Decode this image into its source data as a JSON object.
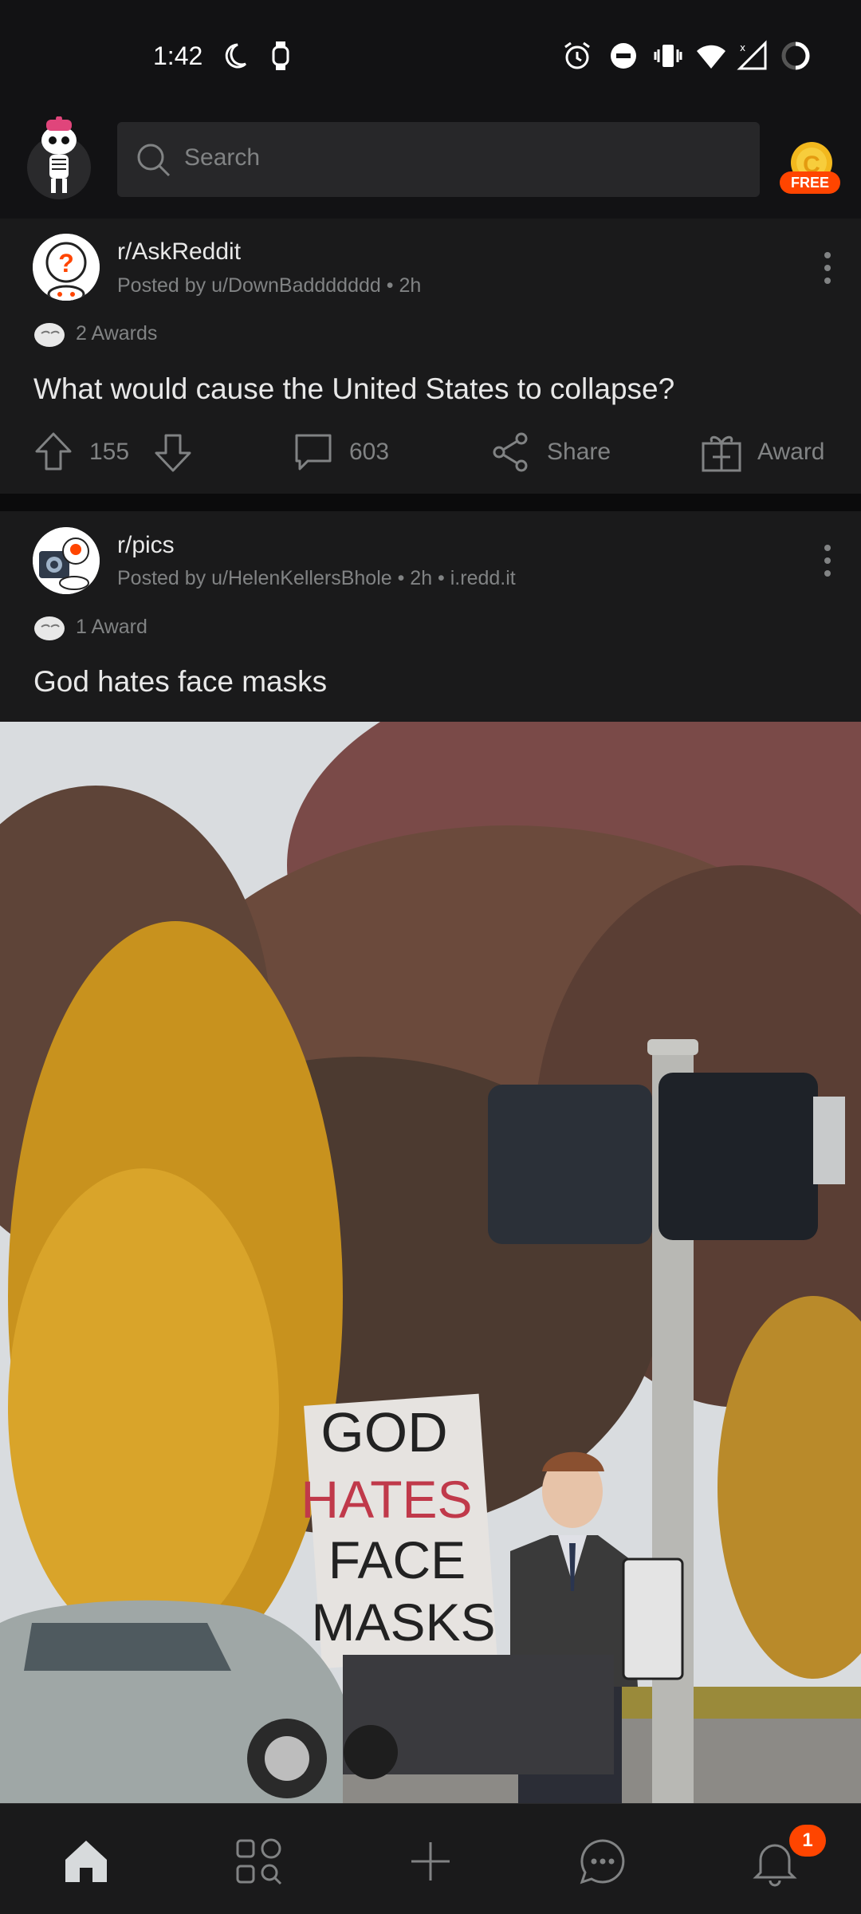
{
  "status_bar": {
    "time": "1:42",
    "left_icons": [
      "moon-icon",
      "watch-icon"
    ],
    "right_icons": [
      "alarm-icon",
      "dnd-icon",
      "vibrate-icon",
      "wifi-icon",
      "signal-icon",
      "battery-icon"
    ]
  },
  "header": {
    "search_placeholder": "Search",
    "coin_badge": "FREE"
  },
  "posts": [
    {
      "subreddit": "r/AskReddit",
      "posted_by": "Posted by u/DownBaddddddd • 2h",
      "awards": "2 Awards",
      "title": "What would cause the United States to collapse?",
      "upvotes": "155",
      "comments": "603",
      "share_label": "Share",
      "award_label": "Award"
    },
    {
      "subreddit": "r/pics",
      "posted_by": "Posted by u/HelenKellersBhole • 2h • i.redd.it",
      "awards": "1 Award",
      "title": "God hates face masks",
      "image_sign_text": [
        "GOD",
        "HATES",
        "FACE",
        "MASKS"
      ]
    }
  ],
  "bottom_nav": {
    "items": [
      "home-icon",
      "discover-icon",
      "create-icon",
      "chat-icon",
      "notifications-icon"
    ],
    "notification_count": "1"
  },
  "colors": {
    "background": "#1a1a1b",
    "accent": "#ff4500",
    "text_primary": "#e8e8e8",
    "text_secondary": "#818384"
  }
}
